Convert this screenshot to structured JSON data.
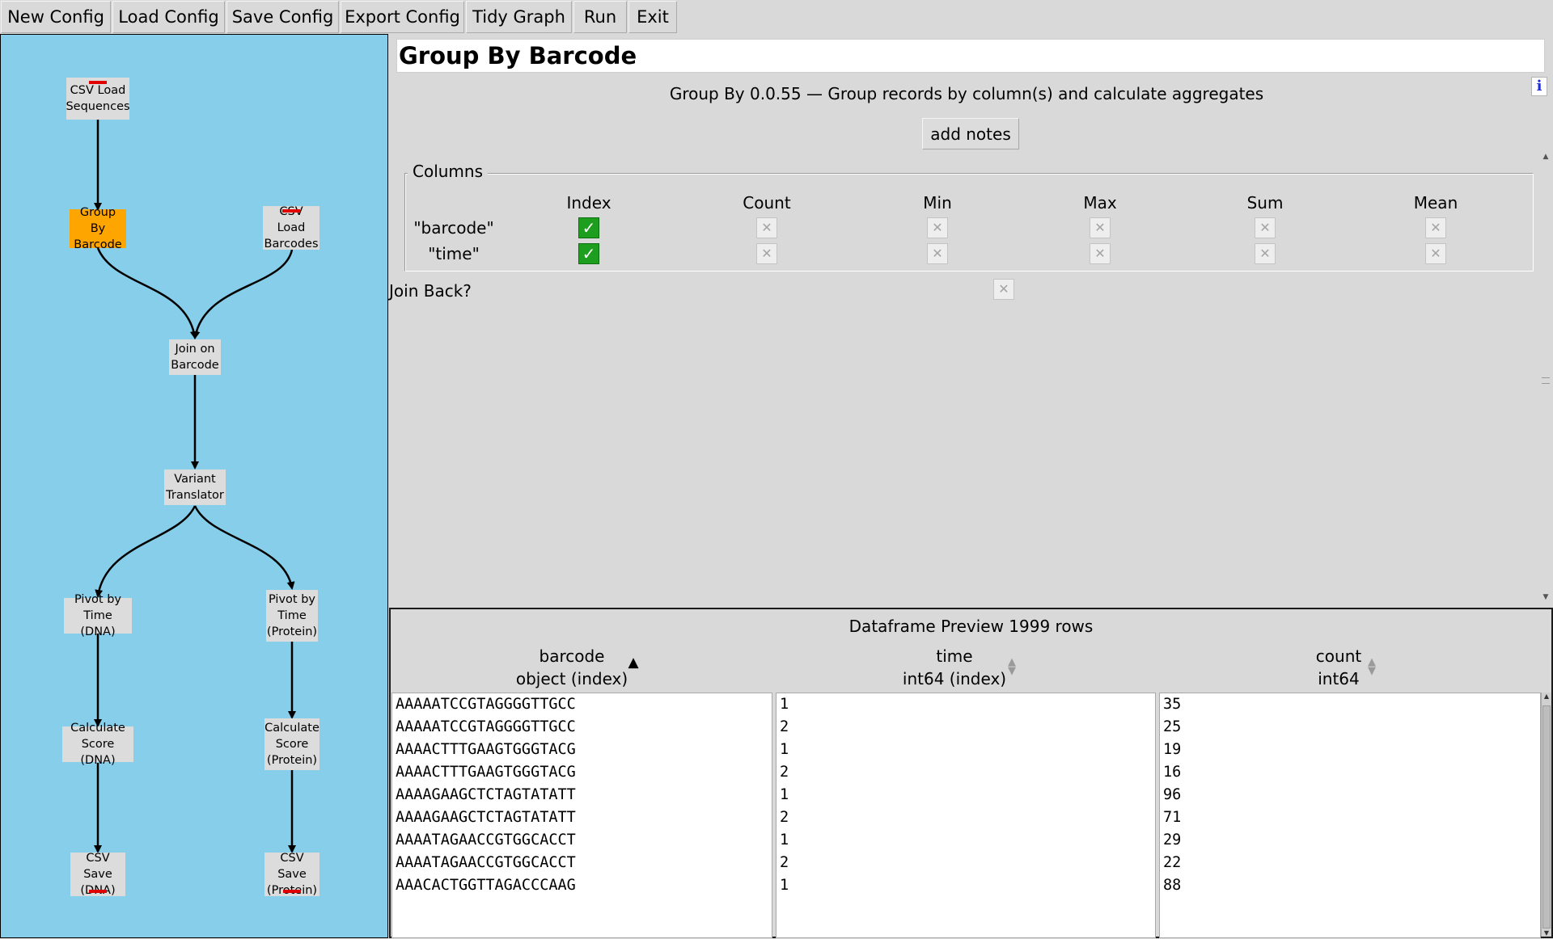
{
  "toolbar": {
    "buttons": [
      "New Config",
      "Load Config",
      "Save Config",
      "Export Config",
      "Tidy Graph",
      "Run",
      "Exit"
    ]
  },
  "graph": {
    "nodes": [
      {
        "label": "CSV Load\nSequences",
        "selected": false,
        "status": "top"
      },
      {
        "label": "Group By\nBarcode",
        "selected": true,
        "status": ""
      },
      {
        "label": "CSV Load\nBarcodes",
        "selected": false,
        "status": "top"
      },
      {
        "label": "Join on\nBarcode",
        "selected": false,
        "status": ""
      },
      {
        "label": "Variant\nTranslator",
        "selected": false,
        "status": ""
      },
      {
        "label": "Pivot by\nTime (DNA)",
        "selected": false,
        "status": ""
      },
      {
        "label": "Pivot by\nTime\n(Protein)",
        "selected": false,
        "status": ""
      },
      {
        "label": "Calculate\nScore (DNA)",
        "selected": false,
        "status": ""
      },
      {
        "label": "Calculate\nScore\n(Protein)",
        "selected": false,
        "status": ""
      },
      {
        "label": "CSV Save\n(DNA)",
        "selected": false,
        "status": "bottom"
      },
      {
        "label": "CSV Save\n(Protein)",
        "selected": false,
        "status": "bottom"
      }
    ],
    "colors": {
      "background": "#87ceeb",
      "node": "#dcdcdc",
      "selected_node": "#ffa500",
      "status_bar": "#e00000"
    }
  },
  "config": {
    "title": "Group By Barcode",
    "info_icon": "i",
    "description": "Group By 0.0.55 — Group records by column(s) and calculate aggregates",
    "add_notes_label": "add notes",
    "columns_legend": "Columns",
    "column_headers": [
      "Index",
      "Count",
      "Min",
      "Max",
      "Sum",
      "Mean"
    ],
    "rows": [
      {
        "label": "\"barcode\"",
        "index": true,
        "count": false,
        "min": false,
        "max": false,
        "sum": false,
        "mean": false
      },
      {
        "label": "\"time\"",
        "index": true,
        "count": false,
        "min": false,
        "max": false,
        "sum": false,
        "mean": false
      }
    ],
    "join_back_label": "Join Back?",
    "join_back": false
  },
  "preview": {
    "title": "Dataframe Preview 1999 rows",
    "columns": [
      {
        "name": "barcode",
        "dtype": "object (index)",
        "sort": "ascending"
      },
      {
        "name": "time",
        "dtype": "int64 (index)",
        "sort": "none"
      },
      {
        "name": "count",
        "dtype": "int64",
        "sort": "none"
      }
    ],
    "barcode": [
      "AAAAATCCGTAGGGGTTGCC",
      "AAAAATCCGTAGGGGTTGCC",
      "AAAACTTTGAAGTGGGTACG",
      "AAAACTTTGAAGTGGGTACG",
      "AAAAGAAGCTCTAGTATATT",
      "AAAAGAAGCTCTAGTATATT",
      "AAAATAGAACCGTGGCACCT",
      "AAAATAGAACCGTGGCACCT",
      "AAACACTGGTTAGACCCAAG"
    ],
    "time": [
      "1",
      "2",
      "1",
      "2",
      "1",
      "2",
      "1",
      "2",
      "1"
    ],
    "count": [
      "35",
      "25",
      "19",
      "16",
      "96",
      "71",
      "29",
      "22",
      "88"
    ]
  }
}
